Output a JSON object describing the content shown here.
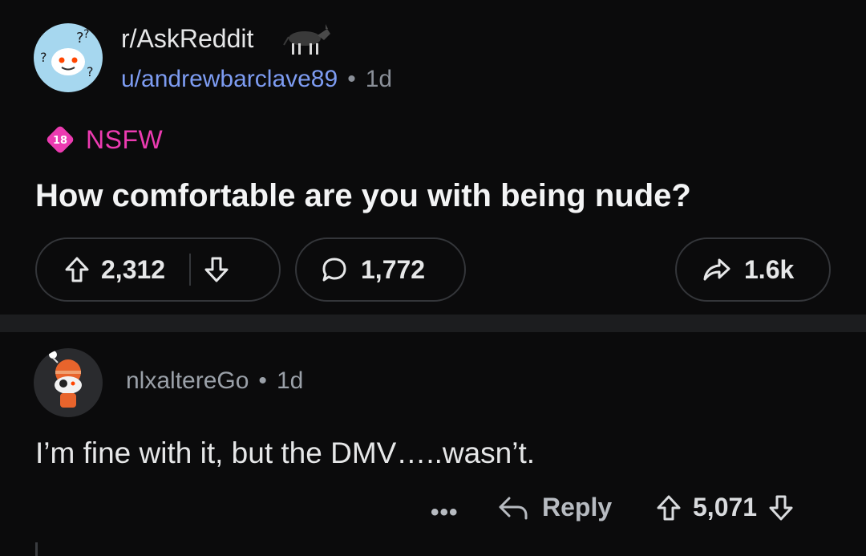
{
  "post": {
    "subreddit": "r/AskReddit",
    "author": "u/andrewbarclave89",
    "separator": "•",
    "age": "1d",
    "nsfw_badge": "18",
    "nsfw_label": "NSFW",
    "title": "How comfortable are you with being nude?",
    "upvotes": "2,312",
    "comments": "1,772",
    "shares": "1.6k"
  },
  "comment": {
    "author": "nlxaltereGo",
    "separator": "•",
    "age": "1d",
    "body": "I’m fine with it, but the DMV…..wasn’t.",
    "more": "•••",
    "reply_label": "Reply",
    "score": "5,071"
  },
  "colors": {
    "background": "#0b0b0c",
    "divider": "#1c1d1f",
    "username_link": "#7d9cf2",
    "nsfw": "#ec3bb1",
    "pill_border": "#34363a"
  },
  "icons": [
    "subreddit-avatar",
    "donkey-flair-icon",
    "nsfw-18-icon",
    "upvote-icon",
    "downvote-icon",
    "comment-bubble-icon",
    "share-icon",
    "user-avatar",
    "more-icon",
    "reply-icon"
  ]
}
